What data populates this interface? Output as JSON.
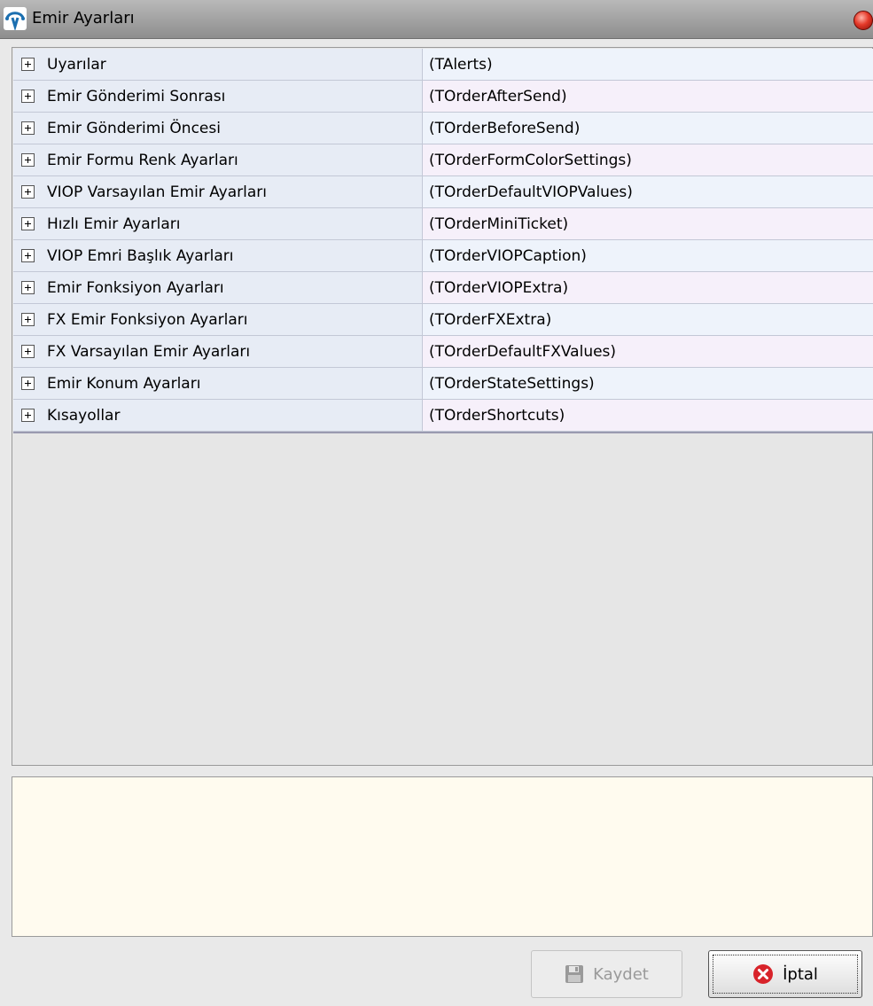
{
  "window": {
    "title": "Emir Ayarları",
    "app_icon": "app-logo-icon",
    "close_icon": "close-icon"
  },
  "tree": {
    "expand_icon": "plus-box-icon",
    "rows": [
      {
        "name": "Uyarılar",
        "class": "(TAlerts)"
      },
      {
        "name": "Emir Gönderimi Sonrası",
        "class": "(TOrderAfterSend)"
      },
      {
        "name": "Emir Gönderimi Öncesi",
        "class": "(TOrderBeforeSend)"
      },
      {
        "name": "Emir Formu Renk Ayarları",
        "class": "(TOrderFormColorSettings)"
      },
      {
        "name": "VIOP Varsayılan Emir Ayarları",
        "class": "(TOrderDefaultVIOPValues)"
      },
      {
        "name": "Hızlı Emir Ayarları",
        "class": "(TOrderMiniTicket)"
      },
      {
        "name": "VIOP Emri Başlık Ayarları",
        "class": "(TOrderVIOPCaption)"
      },
      {
        "name": "Emir Fonksiyon Ayarları",
        "class": "(TOrderVIOPExtra)"
      },
      {
        "name": "FX Emir Fonksiyon Ayarları",
        "class": "(TOrderFXExtra)"
      },
      {
        "name": "FX Varsayılan Emir Ayarları",
        "class": "(TOrderDefaultFXValues)"
      },
      {
        "name": "Emir Konum Ayarları",
        "class": "(TOrderStateSettings)"
      },
      {
        "name": "Kısayollar",
        "class": "(TOrderShortcuts)"
      }
    ]
  },
  "description": "",
  "buttons": {
    "save_label": "Kaydet",
    "save_icon": "floppy-disk-icon",
    "save_enabled": false,
    "cancel_label": "İptal",
    "cancel_icon": "red-x-circle-icon"
  },
  "colors": {
    "description_bg": "#fffbef",
    "close_button": "#e53a2a",
    "cancel_icon": "#d8232a"
  }
}
